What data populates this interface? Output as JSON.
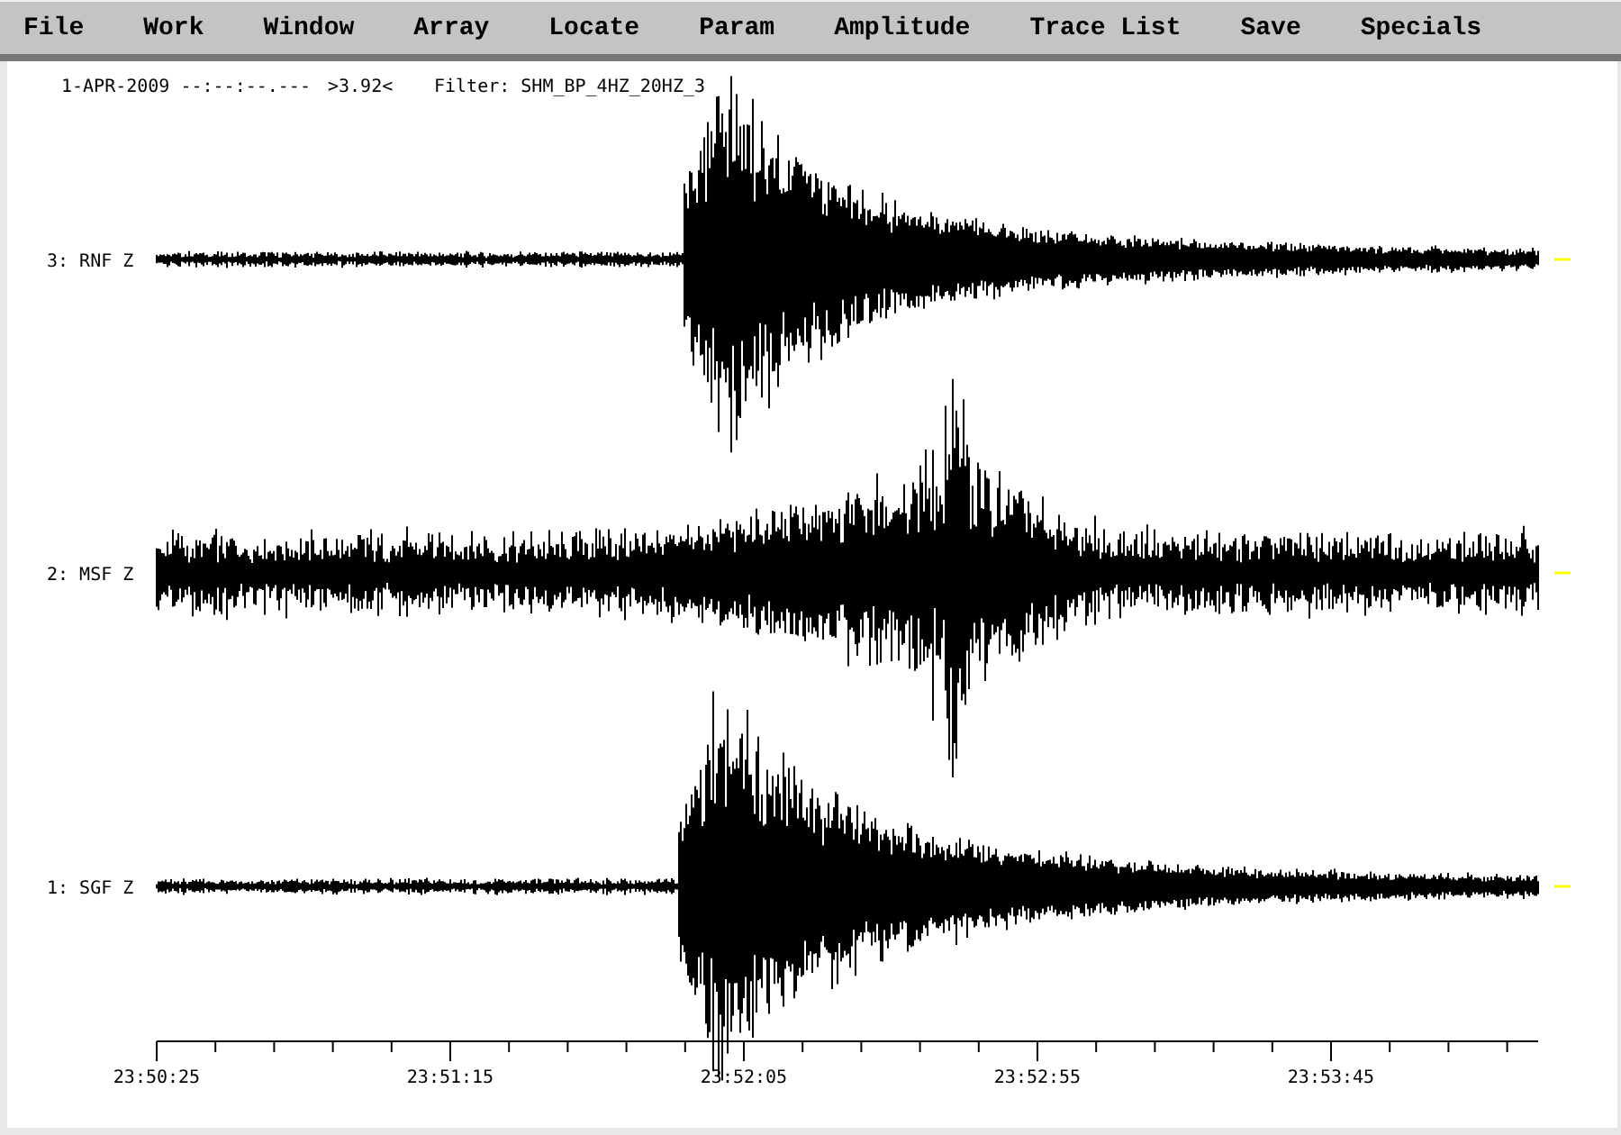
{
  "menu": [
    "File",
    "Work",
    "Window",
    "Array",
    "Locate",
    "Param",
    "Amplitude",
    "Trace List",
    "Save",
    "Specials"
  ],
  "header": {
    "datetime": "1-APR-2009 --:--:--.---",
    "value": ">3.92<",
    "filter": "Filter: SHM_BP_4HZ_20HZ_3"
  },
  "traces": [
    {
      "label": "3: RNF Z"
    },
    {
      "label": "2: MSF Z"
    },
    {
      "label": "1: SGF Z"
    }
  ],
  "time_axis": {
    "labels": [
      "23:50:25",
      "23:51:15",
      "23:52:05",
      "23:52:55",
      "23:53:45"
    ]
  }
}
